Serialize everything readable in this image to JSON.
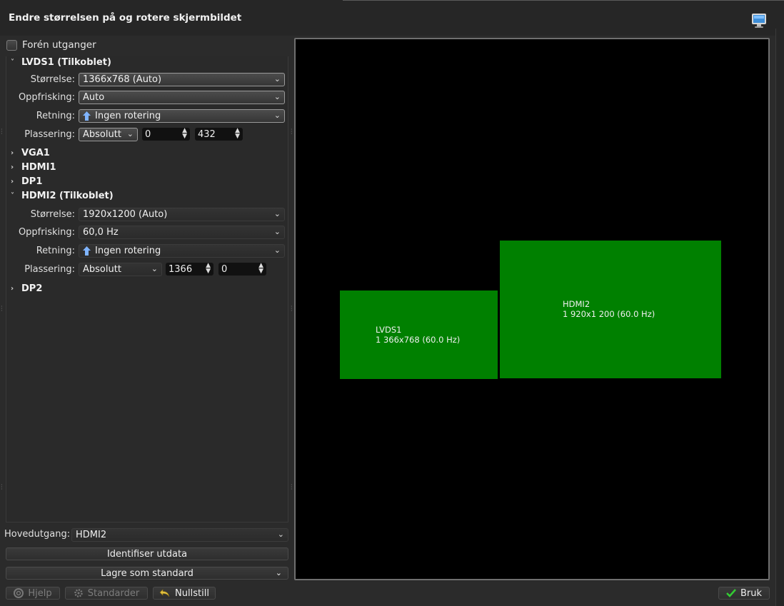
{
  "window": {
    "title": "Endre størrelsen på og rotere skjermbildet"
  },
  "unify": {
    "label": "Forén utganger",
    "checked": false
  },
  "outputs": {
    "lvds1": {
      "header": "LVDS1 (Tilkoblet)",
      "expanded": true,
      "size_label": "Størrelse:",
      "size_value": "1366x768 (Auto)",
      "refresh_label": "Oppfrisking:",
      "refresh_value": "Auto",
      "orientation_label": "Retning:",
      "orientation_value": "Ingen rotering",
      "placement_label": "Plassering:",
      "placement_value": "Absolutt",
      "pos_x": "0",
      "pos_y": "432"
    },
    "vga1": {
      "header": "VGA1",
      "expanded": false
    },
    "hdmi1": {
      "header": "HDMI1",
      "expanded": false
    },
    "dp1": {
      "header": "DP1",
      "expanded": false
    },
    "hdmi2": {
      "header": "HDMI2 (Tilkoblet)",
      "expanded": true,
      "size_label": "Størrelse:",
      "size_value": "1920x1200 (Auto)",
      "refresh_label": "Oppfrisking:",
      "refresh_value": "60,0 Hz",
      "orientation_label": "Retning:",
      "orientation_value": "Ingen rotering",
      "placement_label": "Plassering:",
      "placement_value": "Absolutt",
      "pos_x": "1366",
      "pos_y": "0"
    },
    "dp2": {
      "header": "DP2",
      "expanded": false
    }
  },
  "primary": {
    "label": "Hovedutgang:",
    "value": "HDMI2"
  },
  "identify_button": "Identifiser utdata",
  "save_default_button": "Lagre som standard",
  "footer": {
    "help": "Hjelp",
    "defaults": "Standarder",
    "reset": "Nullstill",
    "apply": "Bruk"
  },
  "preview": {
    "lvds1": {
      "name": "LVDS1",
      "info": "1 366x768 (60.0 Hz)"
    },
    "hdmi2": {
      "name": "HDMI2",
      "info": "1 920x1 200 (60.0 Hz)"
    }
  },
  "colors": {
    "screen_fill": "#008000",
    "preview_bg": "#000000",
    "apply_check": "#33cc33",
    "reset_icon": "#e0c040"
  },
  "icons": {
    "window": "monitor-icon",
    "orientation": "arrow-up-icon",
    "help": "lifebuoy-icon",
    "defaults": "gear-icon",
    "reset": "undo-icon",
    "apply": "checkmark-icon"
  }
}
